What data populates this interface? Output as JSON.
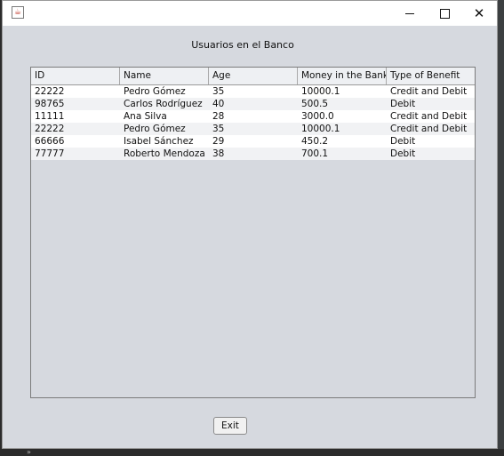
{
  "window": {
    "app_icon_glyph": "☕",
    "controls": {
      "minimize": "minimize",
      "maximize": "maximize",
      "close": "✕"
    }
  },
  "heading": "Usuarios en el Banco",
  "table": {
    "columns": [
      "ID",
      "Name",
      "Age",
      "Money in the Bank",
      "Type of Benefit"
    ],
    "rows": [
      [
        "22222",
        "Pedro Gómez",
        "35",
        "10000.1",
        "Credit and Debit"
      ],
      [
        "98765",
        "Carlos Rodríguez",
        "40",
        "500.5",
        "Debit"
      ],
      [
        "11111",
        "Ana Silva",
        "28",
        "3000.0",
        "Credit and Debit"
      ],
      [
        "22222",
        "Pedro Gómez",
        "35",
        "10000.1",
        "Credit and Debit"
      ],
      [
        "66666",
        "Isabel Sánchez",
        "29",
        "450.2",
        "Debit"
      ],
      [
        "77777",
        "Roberto Mendoza",
        "38",
        "700.1",
        "Debit"
      ]
    ]
  },
  "exit_button_label": "Exit",
  "taskbar_chevron": "»"
}
